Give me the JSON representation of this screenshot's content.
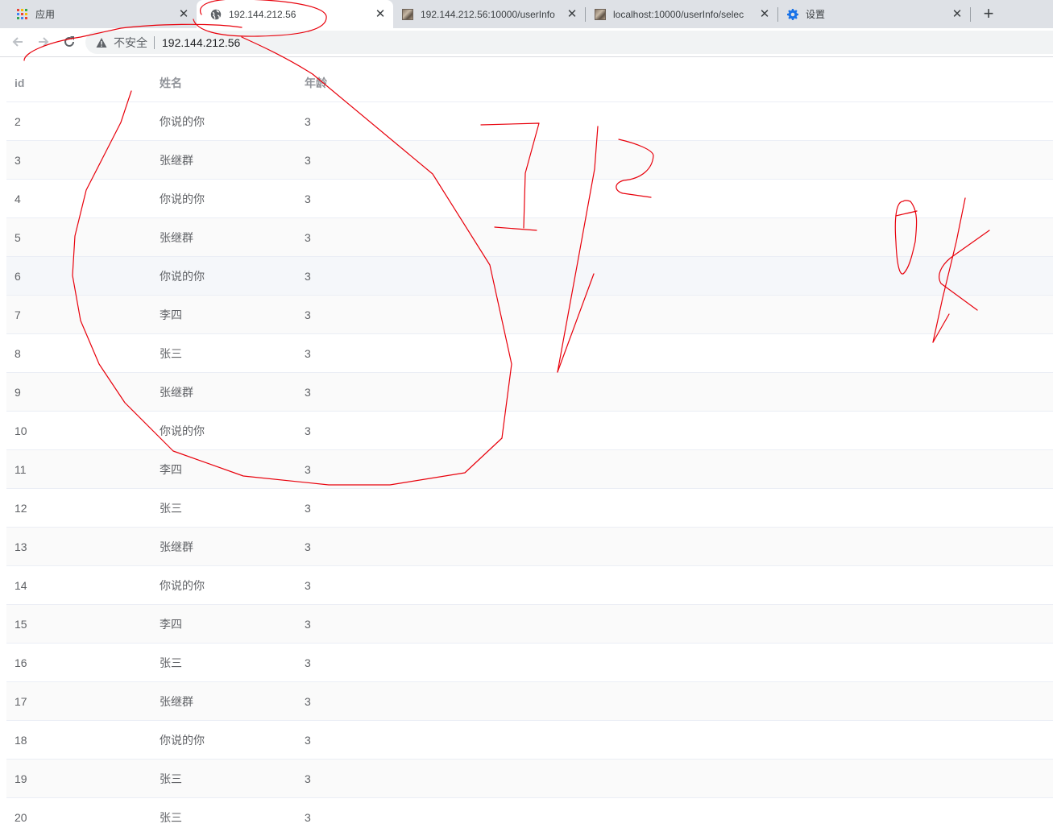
{
  "tabs": [
    {
      "title": "应用",
      "icon": "apps-grid-icon",
      "active": false
    },
    {
      "title": "192.144.212.56",
      "icon": "globe-icon",
      "active": true
    },
    {
      "title": "192.144.212.56:10000/userInfo",
      "icon": "page-thumbnail-icon",
      "active": false
    },
    {
      "title": "localhost:10000/userInfo/selec",
      "icon": "page-thumbnail-icon",
      "active": false
    },
    {
      "title": "设置",
      "icon": "gear-icon",
      "active": false
    }
  ],
  "toolbar": {
    "security_text": "不安全",
    "url": "192.144.212.56",
    "colors": {
      "accent": "#1a73e8",
      "tab_bg": "#dee1e6",
      "omnibox_bg": "#f1f3f4"
    }
  },
  "table": {
    "columns": [
      "id",
      "姓名",
      "年龄"
    ],
    "rows": [
      {
        "id": "2",
        "name": "你说的你",
        "age": "3"
      },
      {
        "id": "3",
        "name": "张继群",
        "age": "3"
      },
      {
        "id": "4",
        "name": "你说的你",
        "age": "3"
      },
      {
        "id": "5",
        "name": "张继群",
        "age": "3"
      },
      {
        "id": "6",
        "name": "你说的你",
        "age": "3"
      },
      {
        "id": "7",
        "name": "李四",
        "age": "3"
      },
      {
        "id": "8",
        "name": "张三",
        "age": "3"
      },
      {
        "id": "9",
        "name": "张继群",
        "age": "3"
      },
      {
        "id": "10",
        "name": "你说的你",
        "age": "3"
      },
      {
        "id": "11",
        "name": "李四",
        "age": "3"
      },
      {
        "id": "12",
        "name": "张三",
        "age": "3"
      },
      {
        "id": "13",
        "name": "张继群",
        "age": "3"
      },
      {
        "id": "14",
        "name": "你说的你",
        "age": "3"
      },
      {
        "id": "15",
        "name": "李四",
        "age": "3"
      },
      {
        "id": "16",
        "name": "张三",
        "age": "3"
      },
      {
        "id": "17",
        "name": "张继群",
        "age": "3"
      },
      {
        "id": "18",
        "name": "你说的你",
        "age": "3"
      },
      {
        "id": "19",
        "name": "张三",
        "age": "3"
      },
      {
        "id": "20",
        "name": "张三",
        "age": "3"
      }
    ]
  },
  "annotation_color": "#e8000b"
}
